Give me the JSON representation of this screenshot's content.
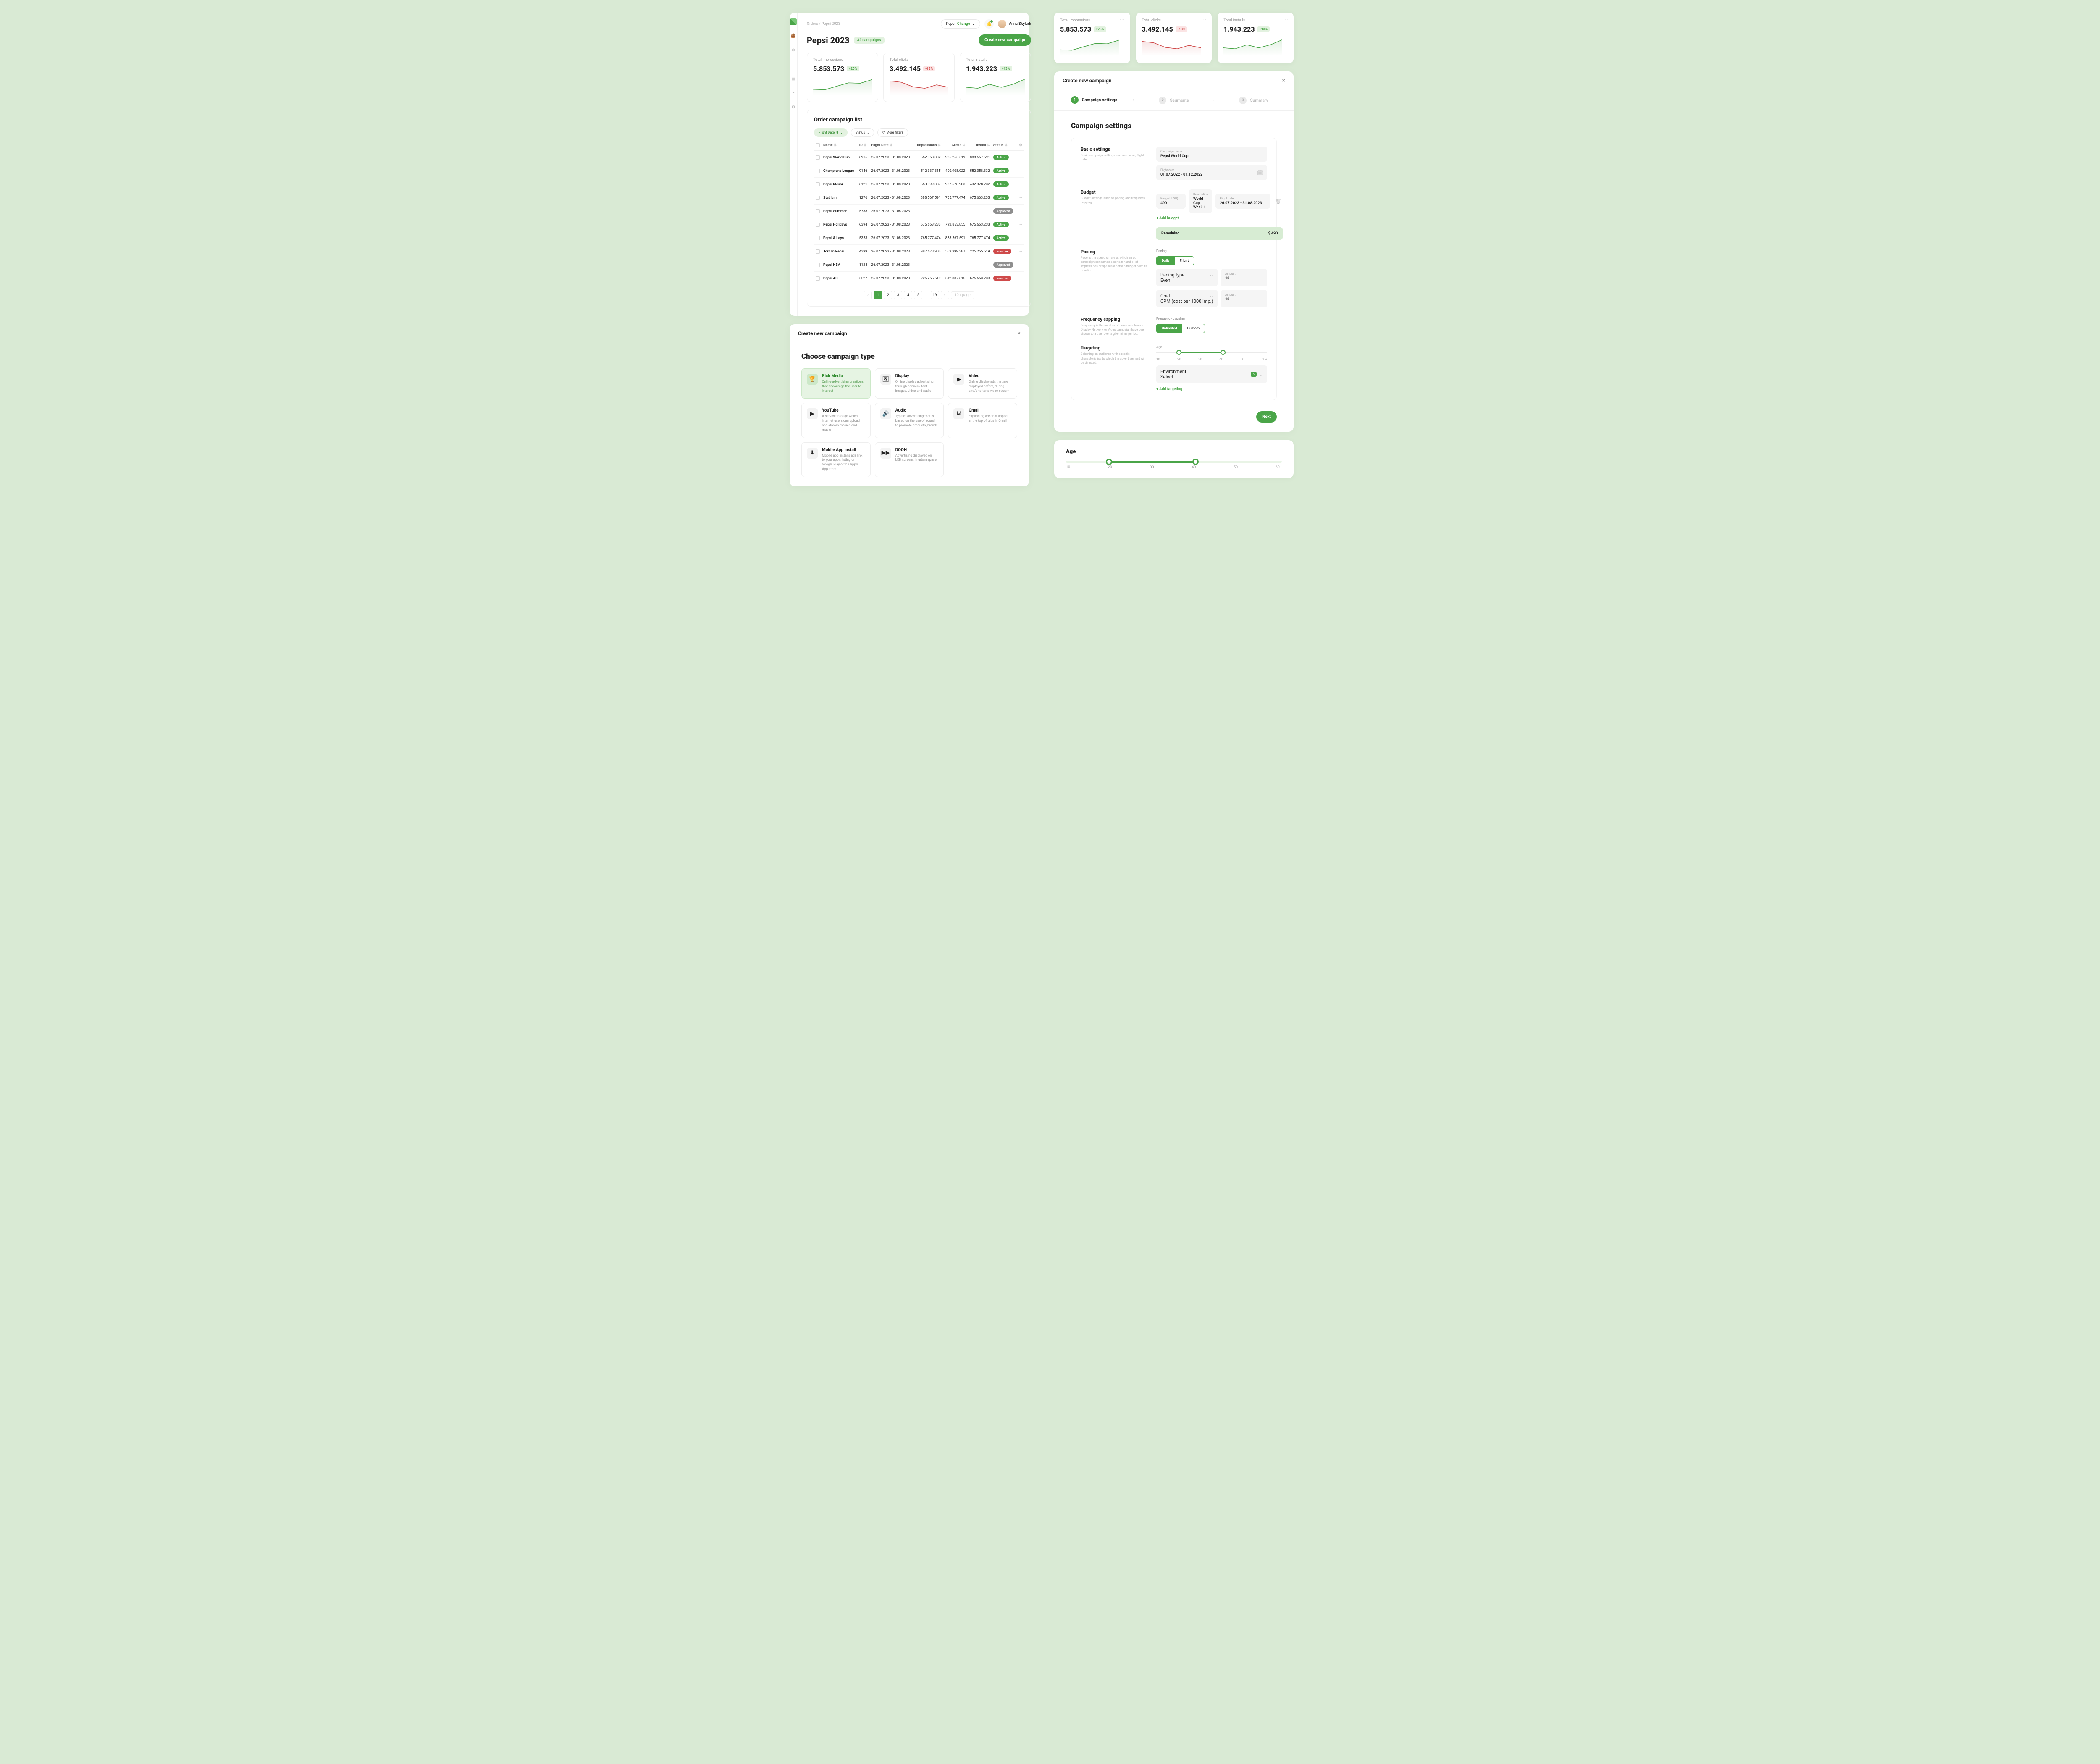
{
  "breadcrumbs": {
    "a": "Orders",
    "b": "Pepsi 2023"
  },
  "brand": {
    "name": "Pepsi",
    "change": "Change"
  },
  "user": {
    "name": "Anna Skylark"
  },
  "page": {
    "title": "Pepsi 2023",
    "campaign_count": "32 campaigns",
    "cta": "Create new campaign"
  },
  "stats": [
    {
      "title": "Total impressions",
      "value": "5.853.573",
      "delta": "+25%",
      "dir": "up",
      "color": "#4aa548"
    },
    {
      "title": "Total clicks",
      "value": "3.492.145",
      "delta": "-13%",
      "dir": "dn",
      "color": "#cf4a4a"
    },
    {
      "title": "Total installs",
      "value": "1.943.223",
      "delta": "+13%",
      "dir": "up",
      "color": "#4aa548"
    }
  ],
  "table": {
    "title": "Order campaign list",
    "filters": {
      "flight": "Flight Date",
      "flight_n": "8",
      "status": "Status",
      "more": "More filters"
    },
    "cols": [
      "Name",
      "ID",
      "Flight Date",
      "Impressions",
      "Clicks",
      "Install",
      "Status"
    ],
    "rows": [
      {
        "name": "Pepsi World Cup",
        "id": "3915",
        "date": "26.07.2023 - 31.08.2023",
        "imp": "552.358.332",
        "clk": "225.255.519",
        "ins": "888.567.591",
        "st": "Active",
        "cls": "active"
      },
      {
        "name": "Champions League",
        "id": "9146",
        "date": "26.07.2023 - 31.08.2023",
        "imp": "512.337.315",
        "clk": "400.908.022",
        "ins": "552.358.332",
        "st": "Active",
        "cls": "active"
      },
      {
        "name": "Pepsi Messi",
        "id": "6121",
        "date": "26.07.2023 - 31.08.2023",
        "imp": "553.399.387",
        "clk": "987.678.903",
        "ins": "432.978.232",
        "st": "Active",
        "cls": "active"
      },
      {
        "name": "Stadium",
        "id": "1276",
        "date": "26.07.2023 - 31.08.2023",
        "imp": "888.567.591",
        "clk": "765.777.474",
        "ins": "675.663.233",
        "st": "Active",
        "cls": "active"
      },
      {
        "name": "Pepsi Summer",
        "id": "5738",
        "date": "26.07.2023 - 31.08.2023",
        "imp": "-",
        "clk": "-",
        "ins": "-",
        "st": "Approved",
        "cls": "approved"
      },
      {
        "name": "Pepsi Holidays",
        "id": "6394",
        "date": "26.07.2023 - 31.08.2023",
        "imp": "675.663.233",
        "clk": "792.853.855",
        "ins": "675.663.233",
        "st": "Active",
        "cls": "active"
      },
      {
        "name": "Pepsi & Lays",
        "id": "5353",
        "date": "26.07.2023 - 31.08.2023",
        "imp": "765.777.474",
        "clk": "888.567.591",
        "ins": "765.777.474",
        "st": "Active",
        "cls": "active"
      },
      {
        "name": "Jordan Pepsi",
        "id": "4399",
        "date": "26.07.2023 - 31.08.2023",
        "imp": "987.678.903",
        "clk": "553.399.387",
        "ins": "225.255.519",
        "st": "Inactive",
        "cls": "inactive"
      },
      {
        "name": "Pepsi NBA",
        "id": "1125",
        "date": "26.07.2023 - 31.08.2023",
        "imp": "-",
        "clk": "-",
        "ins": "-",
        "st": "Approved",
        "cls": "approved"
      },
      {
        "name": "Pepsi AD",
        "id": "5527",
        "date": "26.07.2023 - 31.08.2023",
        "imp": "225.255.519",
        "clk": "512.337.315",
        "ins": "675.663.233",
        "st": "Inactive",
        "cls": "inactive"
      }
    ],
    "pages": [
      "1",
      "2",
      "3",
      "4",
      "5",
      "19"
    ],
    "per_page": "10 / page"
  },
  "modal1": {
    "title": "Create new campaign",
    "heading": "Choose campaign type",
    "types": [
      {
        "icon": "🏆",
        "title": "Rich Media",
        "desc": "Online advertising creations that encourage the user to interact",
        "sel": true
      },
      {
        "icon": "🖼",
        "title": "Display",
        "desc": "Online display advertising through banners, text, images, video and audio"
      },
      {
        "icon": "▶",
        "title": "Video",
        "desc": "Online display ads that are displayed before, during and/or after a video stream"
      },
      {
        "icon": "▶",
        "title": "YouTube",
        "desc": "A service through which internet users can upload and stream movies and music"
      },
      {
        "icon": "🔊",
        "title": "Audio",
        "desc": "Type of advertising that is based on the use of sound to promote products, brands"
      },
      {
        "icon": "M",
        "title": "Gmail",
        "desc": "Expanding ads that appear at the top of tabs in Gmail"
      },
      {
        "icon": "⬇",
        "title": "Mobile App Install",
        "desc": "Mobile app installs ads link to your app's listing on Google Play or the Apple App store"
      },
      {
        "icon": "▶▶",
        "title": "DOOH",
        "desc": "Advertising displayed on LED screens in urban space"
      }
    ]
  },
  "wizard": {
    "title": "Create new campaign",
    "steps": [
      {
        "n": "1",
        "t": "Campaign settings"
      },
      {
        "n": "2",
        "t": "Segments"
      },
      {
        "n": "3",
        "t": "Summary"
      }
    ],
    "heading": "Campaign settings",
    "secs": {
      "basic": {
        "t": "Basic settings",
        "d": "Basic campaign settings such as name, flight date.",
        "name_lbl": "Campaign name",
        "name_val": "Pepsi World Cup",
        "date_lbl": "Flight date",
        "date_val": "01.07.2022 - 01.12.2022"
      },
      "budget": {
        "t": "Budget",
        "d": "Budget settings such as pacing and frequency capping.",
        "b_lbl": "Budget (USD)",
        "b_val": "490",
        "desc_lbl": "Description",
        "desc_val": "World Cup Week 1",
        "fd_lbl": "Flight date",
        "fd_val": "26.07.2023 - 31.08.2023",
        "add": "+  Add budget",
        "rem_t": "Remaining",
        "rem_v": "$ 490"
      },
      "pacing": {
        "t": "Pacing",
        "d": "Pace is the speed or rate at which an ad campaign consumes a certain number of impressions or spends a certain budget over its duration.",
        "sl": "Pacing",
        "opt1": "Daily",
        "opt2": "Flight",
        "pt_lbl": "Pacing type",
        "pt_val": "Even",
        "pa_lbl": "Amount",
        "pa_val": "10",
        "g_lbl": "Goal",
        "g_val": "CPM (cost per 1000 imp.)",
        "ga_val": "10"
      },
      "freq": {
        "t": "Frequency capping",
        "d": "Frequency is the number of times ads from a Display Network or Video campaign have been shown to a user over a given time period.",
        "sl": "Frequency capping",
        "opt1": "Unlimited",
        "opt2": "Custom"
      },
      "target": {
        "t": "Targeting",
        "d": "Selecting an audience with specific characteristics to which the advertisement will be directed.",
        "age": "Age",
        "ticks": [
          "10",
          "20",
          "30",
          "40",
          "50",
          "60+"
        ],
        "env_lbl": "Environment",
        "env_val": "Select",
        "env_badge": "5",
        "add": "+  Add targeting"
      }
    },
    "next": "Next"
  },
  "zoom": {
    "t": "Age",
    "ticks": [
      "10",
      "20",
      "30",
      "40",
      "50",
      "60+"
    ]
  },
  "chart_data": [
    {
      "type": "line",
      "title": "Total impressions",
      "series": [
        {
          "name": "impressions",
          "values": [
            30,
            28,
            45,
            62,
            60,
            78
          ]
        }
      ],
      "ylim": [
        0,
        100
      ],
      "color": "#4aa548"
    },
    {
      "type": "line",
      "title": "Total clicks",
      "series": [
        {
          "name": "clicks",
          "values": [
            72,
            65,
            42,
            35,
            52,
            40
          ]
        }
      ],
      "ylim": [
        0,
        100
      ],
      "color": "#cf4a4a"
    },
    {
      "type": "line",
      "title": "Total installs",
      "series": [
        {
          "name": "installs",
          "values": [
            40,
            35,
            55,
            40,
            55,
            80
          ]
        }
      ],
      "ylim": [
        0,
        100
      ],
      "color": "#4aa548"
    }
  ]
}
